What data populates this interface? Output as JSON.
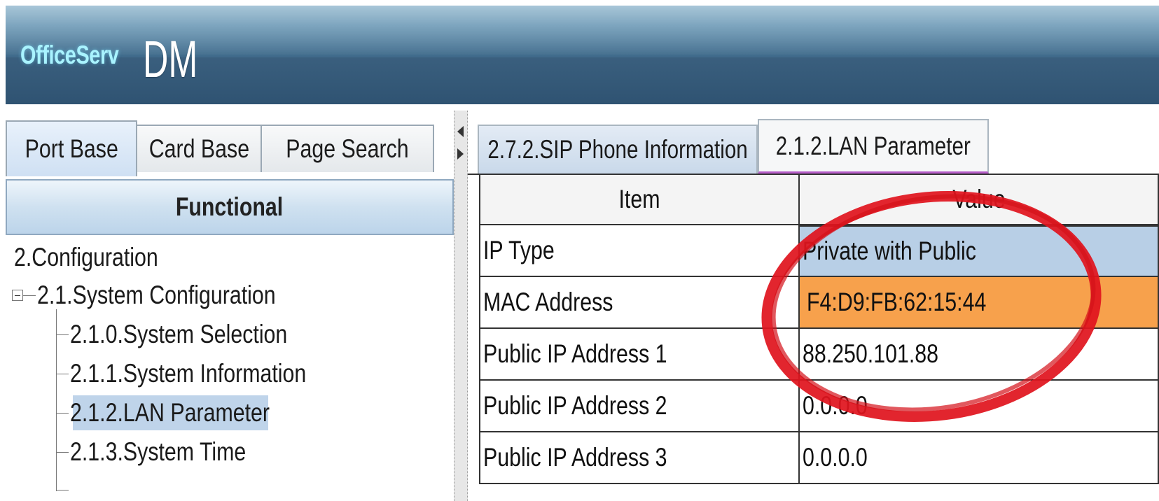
{
  "header": {
    "logo_small": "OfficeServ",
    "logo_big": "DM"
  },
  "left_tabs": [
    {
      "label": "Port Base"
    },
    {
      "label": "Card Base"
    },
    {
      "label": "Page Search"
    }
  ],
  "functional_label": "Functional",
  "tree": {
    "root": "2.Configuration",
    "group": "2.1.System Configuration",
    "items": [
      {
        "label": "2.1.0.System Selection"
      },
      {
        "label": "2.1.1.System Information"
      },
      {
        "label": "2.1.2.LAN Parameter"
      },
      {
        "label": "2.1.3.System Time"
      }
    ]
  },
  "right_tabs": [
    {
      "label": "2.7.2.SIP Phone Information"
    },
    {
      "label": "2.1.2.LAN Parameter"
    }
  ],
  "grid": {
    "columns": [
      "Item",
      "Value"
    ],
    "rows": [
      {
        "item": "IP Type",
        "value": "Private with Public"
      },
      {
        "item": "MAC Address",
        "value": "F4:D9:FB:62:15:44"
      },
      {
        "item": "Public IP Address 1",
        "value": "88.250.101.88"
      },
      {
        "item": "Public IP Address 2",
        "value": "0.0.0.0"
      },
      {
        "item": "Public IP Address 3",
        "value": "0.0.0.0"
      }
    ]
  },
  "colors": {
    "selected_value_bg": "#b8cfe6",
    "highlight_value_bg": "#f7a14c",
    "annotation": "#e0141e"
  }
}
